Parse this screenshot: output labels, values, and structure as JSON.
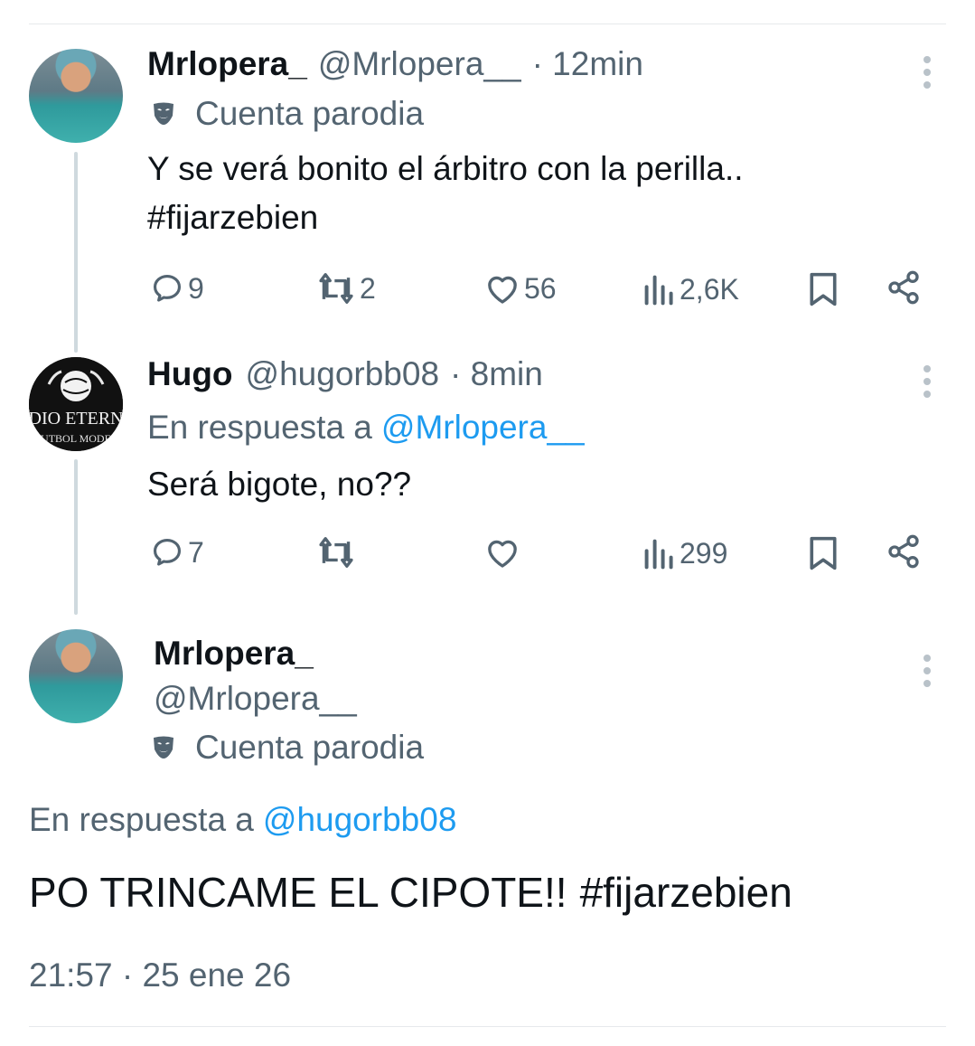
{
  "tweets": [
    {
      "display_name": "Mrlopera_",
      "handle": "@Mrlopera__",
      "time": "· 12min",
      "parody_label": "Cuenta parodia",
      "text": "Y se verá bonito el árbitro con la perilla..",
      "hashtag": "#fijarzebien",
      "replies": "9",
      "retweets": "2",
      "likes": "56",
      "views": "2,6K"
    },
    {
      "display_name": "Hugo",
      "handle": "@hugorbb08",
      "time": "· 8min",
      "reply_prefix": "En respuesta a",
      "reply_to": "@Mrlopera__",
      "text": "Será bigote, no??",
      "replies": "7",
      "retweets": "",
      "likes": "",
      "views": "299"
    }
  ],
  "main_tweet": {
    "display_name": "Mrlopera_",
    "handle": "@Mrlopera__",
    "parody_label": "Cuenta parodia",
    "reply_prefix": "En respuesta a",
    "reply_to": "@hugorbb08",
    "text": "PO TRINCAME EL CIPOTE!!",
    "hashtag": "#fijarzebien",
    "timestamp": "21:57 · 25 ene 26"
  },
  "avatar_texts": {
    "hugo_line1": "DIO ETERN",
    "hugo_line2": "UTBOL MODE"
  },
  "colors": {
    "link": "#1d9bf0",
    "muted": "#536471",
    "text": "#0f1419",
    "thread_line": "#cfd9de"
  },
  "icons": [
    "reply-icon",
    "retweet-icon",
    "like-icon",
    "views-icon",
    "bookmark-icon",
    "share-icon",
    "more-icon",
    "parody-mask-icon"
  ]
}
